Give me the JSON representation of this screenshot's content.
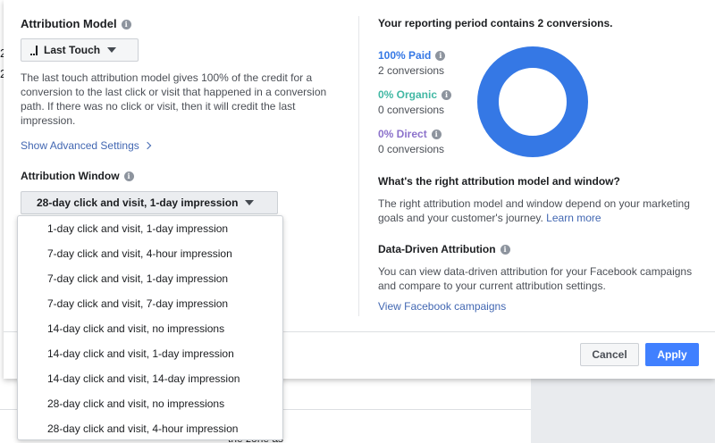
{
  "background": {
    "fragments": [
      "2",
      "2"
    ],
    "bottom_text": "the zone as"
  },
  "attribution_model": {
    "heading": "Attribution Model",
    "selected": "Last Touch",
    "selected_icon": "bar-chart-icon",
    "description": "The last touch attribution model gives 100% of the credit for a conversion to the last click or visit that happened in a conversion path. If there was no click or visit, then it will credit the last impression.",
    "advanced_link": "Show Advanced Settings"
  },
  "attribution_window": {
    "heading": "Attribution Window",
    "selected": "28-day click and visit, 1-day impression",
    "options": [
      "1-day click and visit, 1-day impression",
      "7-day click and visit, 4-hour impression",
      "7-day click and visit, 1-day impression",
      "7-day click and visit, 7-day impression",
      "14-day click and visit, no impressions",
      "14-day click and visit, 1-day impression",
      "14-day click and visit, 14-day impression",
      "28-day click and visit, no impressions",
      "28-day click and visit, 4-hour impression"
    ]
  },
  "reporting": {
    "heading": "Your reporting period contains 2 conversions.",
    "stats": [
      {
        "label": "100% Paid",
        "sub": "2 conversions",
        "color": "#3578e5",
        "share": 1.0
      },
      {
        "label": "0% Organic",
        "sub": "0 conversions",
        "color": "#42b8a4",
        "share": 0.0
      },
      {
        "label": "0% Direct",
        "sub": "0 conversions",
        "color": "#8c72cb",
        "share": 0.0
      }
    ]
  },
  "help": {
    "heading": "What's the right attribution model and window?",
    "text": "The right attribution model and window depend on your marketing goals and your customer's journey.",
    "link": "Learn more"
  },
  "data_driven": {
    "heading": "Data-Driven Attribution",
    "text": "You can view data-driven attribution for your Facebook campaigns and compare to your current attribution settings.",
    "link": "View Facebook campaigns"
  },
  "footer": {
    "cancel": "Cancel",
    "apply": "Apply"
  }
}
